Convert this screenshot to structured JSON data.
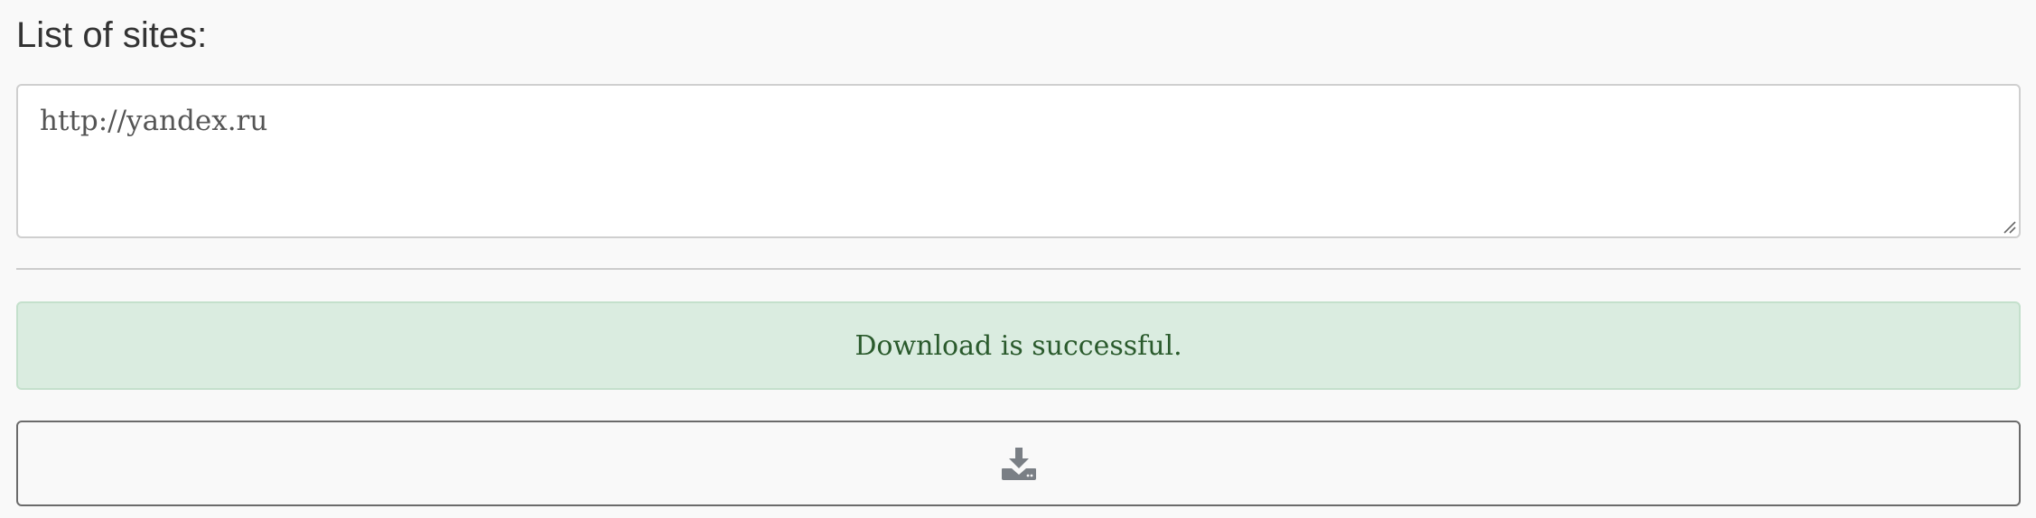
{
  "form": {
    "title": "List of sites:",
    "sites_value": "http://yandex.ru"
  },
  "alert": {
    "message": "Download is successful.",
    "status": "success",
    "background_color": "#daece0",
    "text_color": "#2a5a2c"
  },
  "download_button": {
    "icon": "download-icon"
  }
}
